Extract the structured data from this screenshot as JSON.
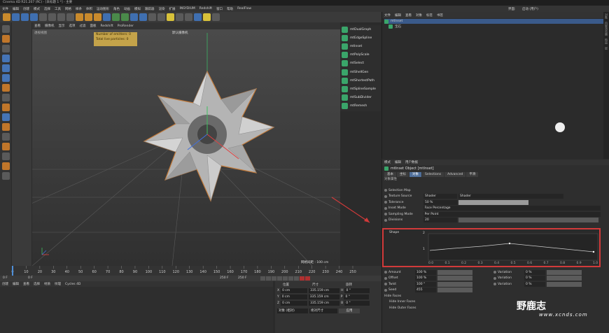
{
  "window": {
    "title": "Cinema 4D R21.207 (RC) - [未标题 1 *] - 主要"
  },
  "menu": [
    "文件",
    "编辑",
    "创建",
    "模式",
    "选择",
    "工具",
    "网格",
    "样条",
    "体积",
    "运动图形",
    "角色",
    "动画",
    "模拟",
    "跟踪器",
    "渲染",
    "扩展",
    "INSYDIUM",
    "Redshift",
    "窗口",
    "帮助",
    "RealFlow"
  ],
  "viewport_menu": [
    "查看",
    "摄像机",
    "显示",
    "选项",
    "过滤",
    "面板",
    "Redshift",
    "ProRender"
  ],
  "viewport": {
    "label": "透视视图",
    "camera": "默认摄像机",
    "hud": {
      "emitters": "Number of emitters: 0",
      "particles": "Total live particles: 0"
    },
    "grid_spacing": "网格间距 : 100 cm"
  },
  "plugin_menu": [
    "mtDualGraph",
    "mtEdgeSpline",
    "mtInset",
    "mtPolyScale",
    "mtSelect",
    "mtShellGen",
    "mtShortestPath",
    "mtSplineSample",
    "mtSubDivider",
    "mtRemesh"
  ],
  "object_manager": {
    "menu": [
      "文件",
      "编辑",
      "查看",
      "对象",
      "标签",
      "书签"
    ],
    "items": [
      {
        "name": "mtInset",
        "selected": true
      },
      {
        "name": "宝石",
        "selected": false
      }
    ]
  },
  "layout": {
    "label": "界面:",
    "value": "启动 (用户)"
  },
  "attribute_manager": {
    "menu": [
      "模式",
      "编辑",
      "用户数据"
    ],
    "title": "mtInset Object [mtInset]",
    "tabs": [
      {
        "label": "基本",
        "active": false
      },
      {
        "label": "坐标",
        "active": false
      },
      {
        "label": "对象",
        "active": true
      },
      {
        "label": "Selections",
        "active": false
      },
      {
        "label": "Advanced",
        "active": false
      },
      {
        "label": "平滑",
        "active": false
      }
    ],
    "section": "对象属性",
    "rows": [
      {
        "label": "Selection Map",
        "value": ""
      },
      {
        "label": "Texture Source",
        "value": "Shader",
        "extra": "Shader"
      },
      {
        "label": "Tolerance",
        "value": "50 %"
      },
      {
        "label": "Inset Mode",
        "value": "Face Percentage"
      },
      {
        "label": "Sampling Mode",
        "value": "Per Point"
      },
      {
        "label": "Divisions",
        "value": "20"
      }
    ],
    "shape": {
      "label": "Shape",
      "y_ticks": [
        "2",
        "1"
      ],
      "x_ticks": [
        "0.0",
        "0.1",
        "0.2",
        "0.3",
        "0.4",
        "0.5",
        "0.6",
        "0.7",
        "0.8",
        "0.9",
        "1.0"
      ]
    },
    "bottom_rows": [
      {
        "left": {
          "label": "Amount",
          "value": "100 %"
        },
        "right": {
          "label": "Variation",
          "value": "0 %"
        }
      },
      {
        "left": {
          "label": "Offset",
          "value": "100 %"
        },
        "right": {
          "label": "Variation",
          "value": "0 %"
        }
      },
      {
        "left": {
          "label": "Twist",
          "value": "100 °"
        },
        "right": {
          "label": "Variation",
          "value": "0 %"
        }
      },
      {
        "left": {
          "label": "Seed",
          "value": "455"
        },
        "right": null
      }
    ],
    "hide_faces": {
      "label": "Hide Faces",
      "inner": "Hide Inner Faces",
      "outer": "Hide Outer Faces"
    }
  },
  "timeline": {
    "ticks": [
      "0",
      "10",
      "20",
      "30",
      "40",
      "50",
      "60",
      "70",
      "80",
      "90",
      "100",
      "110",
      "120",
      "130",
      "140",
      "150",
      "160",
      "170",
      "180",
      "190",
      "200",
      "210",
      "220",
      "230",
      "240",
      "250"
    ],
    "current": "0 F",
    "start": "0 F",
    "end": "250 F",
    "end2": "250 F"
  },
  "material_menu": [
    "创建",
    "编辑",
    "查看",
    "选择",
    "材质",
    "纹理",
    "Cycles 4D"
  ],
  "coordinates": {
    "headers": [
      "位置",
      "尺寸",
      "旋转"
    ],
    "rows": [
      {
        "axis": "X",
        "pos": "0 cm",
        "size": "335.159 cm",
        "rot_label": "H",
        "rot": "0 °"
      },
      {
        "axis": "Y",
        "pos": "0 cm",
        "size": "335.159 cm",
        "rot_label": "P",
        "rot": "0 °"
      },
      {
        "axis": "Z",
        "pos": "0 cm",
        "size": "335.159 cm",
        "rot_label": "B",
        "rot": "0 °"
      }
    ],
    "mode": "对象 (相对)",
    "size_mode": "绝对尺寸",
    "apply": "应用"
  },
  "side_tabs": [
    "对象",
    "内容浏览器",
    "构造",
    "层"
  ],
  "watermark": {
    "text": "野鹿志",
    "url": "www.xcnds.com"
  },
  "colors": {
    "accent": "#4f6f9a",
    "highlight_border": "#d23a3a",
    "hud": "#c4a34a"
  }
}
